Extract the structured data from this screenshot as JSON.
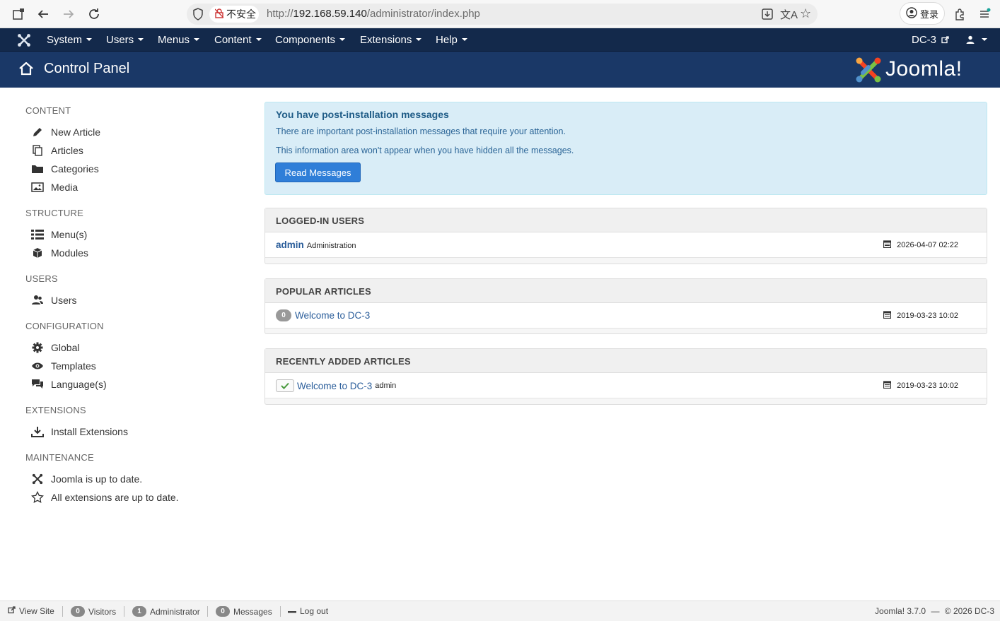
{
  "browser": {
    "security_label": "不安全",
    "url_prefix": "http://",
    "url_host": "192.168.59.140",
    "url_path": "/administrator/index.php",
    "login_label": "登录"
  },
  "topnav": {
    "items": [
      {
        "label": "System"
      },
      {
        "label": "Users"
      },
      {
        "label": "Menus"
      },
      {
        "label": "Content"
      },
      {
        "label": "Components"
      },
      {
        "label": "Extensions"
      },
      {
        "label": "Help"
      }
    ],
    "site_name": "DC-3"
  },
  "header": {
    "title": "Control Panel",
    "brand": "Joomla!"
  },
  "sidebar": {
    "sections": [
      {
        "title": "CONTENT",
        "items": [
          {
            "label": "New Article",
            "icon": "pencil-icon"
          },
          {
            "label": "Articles",
            "icon": "copy-icon"
          },
          {
            "label": "Categories",
            "icon": "folder-icon"
          },
          {
            "label": "Media",
            "icon": "image-icon"
          }
        ]
      },
      {
        "title": "STRUCTURE",
        "items": [
          {
            "label": "Menu(s)",
            "icon": "list-icon"
          },
          {
            "label": "Modules",
            "icon": "cube-icon"
          }
        ]
      },
      {
        "title": "USERS",
        "items": [
          {
            "label": "Users",
            "icon": "users-icon"
          }
        ]
      },
      {
        "title": "CONFIGURATION",
        "items": [
          {
            "label": "Global",
            "icon": "cog-icon"
          },
          {
            "label": "Templates",
            "icon": "eye-icon"
          },
          {
            "label": "Language(s)",
            "icon": "comments-icon"
          }
        ]
      },
      {
        "title": "EXTENSIONS",
        "items": [
          {
            "label": "Install Extensions",
            "icon": "download-icon"
          }
        ]
      },
      {
        "title": "MAINTENANCE",
        "items": [
          {
            "label": "Joomla is up to date.",
            "icon": "joomla-icon"
          },
          {
            "label": "All extensions are up to date.",
            "icon": "star-icon"
          }
        ]
      }
    ]
  },
  "alert": {
    "title": "You have post-installation messages",
    "line1": "There are important post-installation messages that require your attention.",
    "line2": "This information area won't appear when you have hidden all the messages.",
    "button": "Read Messages"
  },
  "panels": {
    "logged_in": {
      "title": "LOGGED-IN USERS",
      "rows": [
        {
          "name": "admin",
          "role": "Administration",
          "date": "2026-04-07 02:22"
        }
      ]
    },
    "popular": {
      "title": "POPULAR ARTICLES",
      "rows": [
        {
          "hits": "0",
          "title": "Welcome to DC-3",
          "date": "2019-03-23 10:02"
        }
      ]
    },
    "recent": {
      "title": "RECENTLY ADDED ARTICLES",
      "rows": [
        {
          "title": "Welcome to DC-3",
          "author": "admin",
          "date": "2019-03-23 10:02"
        }
      ]
    }
  },
  "statusbar": {
    "view_site": "View Site",
    "visitors_count": "0",
    "visitors_label": "Visitors",
    "admin_count": "1",
    "admin_label": "Administrator",
    "messages_count": "0",
    "messages_label": "Messages",
    "logout": "Log out",
    "version": "Joomla! 3.7.0",
    "copyright": "© 2026 DC-3"
  },
  "colors": {
    "topnav_bg": "#13294b",
    "header_bg": "#1a3867",
    "alert_bg": "#d9edf7",
    "link": "#2a5d9a",
    "button": "#2f7ed8"
  }
}
